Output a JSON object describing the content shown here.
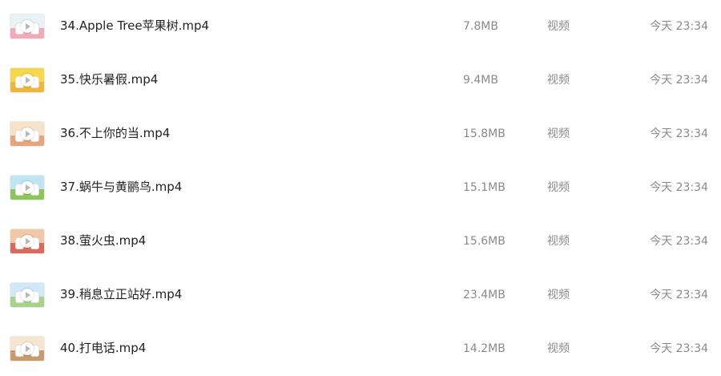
{
  "files": [
    {
      "name": "34.Apple Tree苹果树.mp4",
      "size": "7.8MB",
      "type": "视频",
      "time": "今天 23:34",
      "thumb_colors": [
        "#e8f3f8",
        "#f4a9b6"
      ]
    },
    {
      "name": "35.快乐暑假.mp4",
      "size": "9.4MB",
      "type": "视频",
      "time": "今天 23:34",
      "thumb_colors": [
        "#f8d84a",
        "#f3b43a"
      ]
    },
    {
      "name": "36.不上你的当.mp4",
      "size": "15.8MB",
      "type": "视频",
      "time": "今天 23:34",
      "thumb_colors": [
        "#f6e3c8",
        "#e9a47a"
      ]
    },
    {
      "name": "37.蜗牛与黄鹂鸟.mp4",
      "size": "15.1MB",
      "type": "视频",
      "time": "今天 23:34",
      "thumb_colors": [
        "#bfe5f2",
        "#8cc65a"
      ]
    },
    {
      "name": "38.萤火虫.mp4",
      "size": "15.6MB",
      "type": "视频",
      "time": "今天 23:34",
      "thumb_colors": [
        "#f1c8a7",
        "#d96a5b"
      ]
    },
    {
      "name": "39.稍息立正站好.mp4",
      "size": "23.4MB",
      "type": "视频",
      "time": "今天 23:34",
      "thumb_colors": [
        "#cfe9f6",
        "#a7d48a"
      ]
    },
    {
      "name": "40.打电话.mp4",
      "size": "14.2MB",
      "type": "视频",
      "time": "今天 23:34",
      "thumb_colors": [
        "#f7e6cf",
        "#c99a6a"
      ]
    }
  ]
}
